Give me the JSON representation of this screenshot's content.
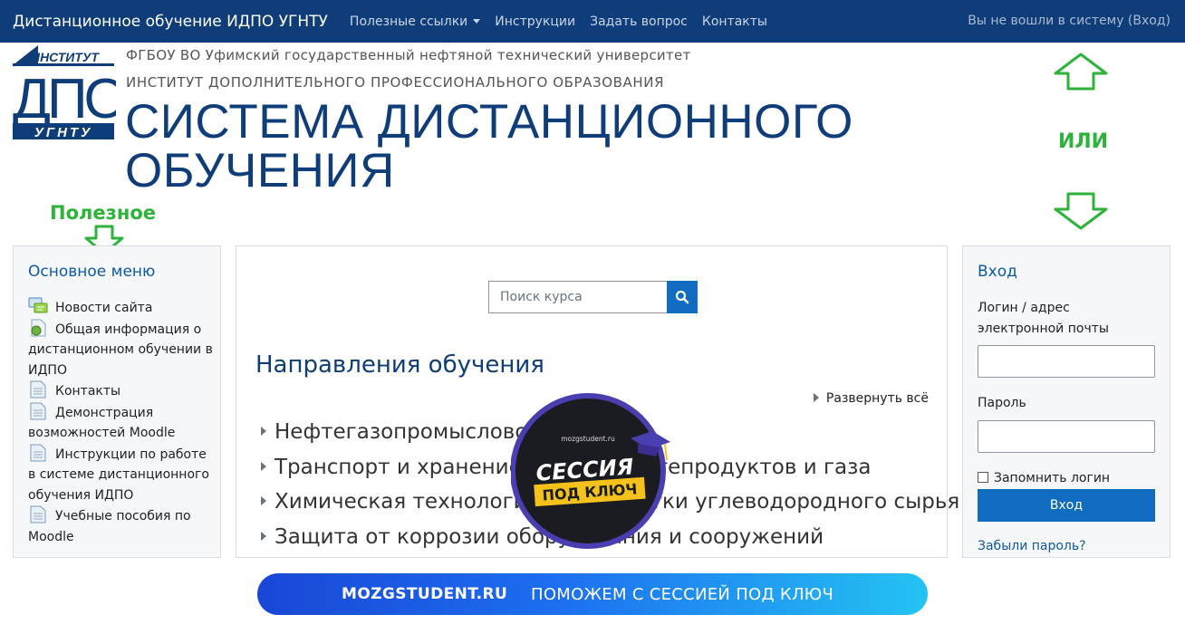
{
  "navbar": {
    "brand": "Дистанционное обучение ИДПО УГНТУ",
    "links": [
      "Полезные ссылки",
      "Инструкции",
      "Задать вопрос",
      "Контакты"
    ],
    "login_status": "Вы не вошли в систему (Вход)"
  },
  "header": {
    "logo_top": "ИНСТИТУТ",
    "logo_main": "ДПО",
    "logo_bottom": "УГНТУ",
    "university": "ФГБОУ ВО Уфимский государственный нефтяной технический университет",
    "institute": "ИНСТИТУТ ДОПОЛНИТЕЛЬНОГО ПРОФЕССИОНАЛЬНОГО ОБРАЗОВАНИЯ",
    "title_line1": "СИСТЕМА ДИСТАНЦИОННОГО",
    "title_line2": "ОБУЧЕНИЯ"
  },
  "annotations": {
    "ili": "ИЛИ",
    "poleznoe": "Полезное",
    "color": "#2db23a"
  },
  "main_menu": {
    "title": "Основное меню",
    "items": [
      {
        "label": "Новости сайта",
        "icon": "forum-icon"
      },
      {
        "label": "Общая информация о дистанционном обучении в ИДПО",
        "icon": "url-icon"
      },
      {
        "label": "Контакты",
        "icon": "page-icon"
      },
      {
        "label": "Демонстрация возможностей Moodle",
        "icon": "page-icon"
      },
      {
        "label": "Инструкции по работе в системе дистанционного обучения ИДПО",
        "icon": "page-icon"
      },
      {
        "label": "Учебные пособия по Moodle",
        "icon": "page-icon"
      }
    ]
  },
  "center": {
    "search_placeholder": "Поиск курса",
    "directions_title": "Направления обучения",
    "expand_all": "Развернуть всё",
    "courses": [
      "Нефтегазопромысловое дело",
      "Транспорт и хранение нефти, нефтепродуктов и газа",
      "Химическая технология переработки углеводородного сырья",
      "Защита от коррозии оборудования и сооружений"
    ]
  },
  "login": {
    "title": "Вход",
    "username_label": "Логин / адрес электронной почты",
    "password_label": "Пароль",
    "remember_label": "Запомнить логин",
    "submit_label": "Вход",
    "forgot_label": "Забыли пароль?"
  },
  "ad": {
    "badge_site": "mozgstudent.ru",
    "badge_line1": "СЕССИЯ",
    "badge_line2": "ПОД КЛЮЧ",
    "banner_site": "MOZGSTUDENT.RU",
    "banner_slogan": "ПОМОЖЕМ С СЕССИЕЙ ПОД КЛЮЧ"
  },
  "colors": {
    "navbar": "#0f3d7a",
    "primary": "#0f6cbf",
    "title": "#0f3d7a"
  }
}
